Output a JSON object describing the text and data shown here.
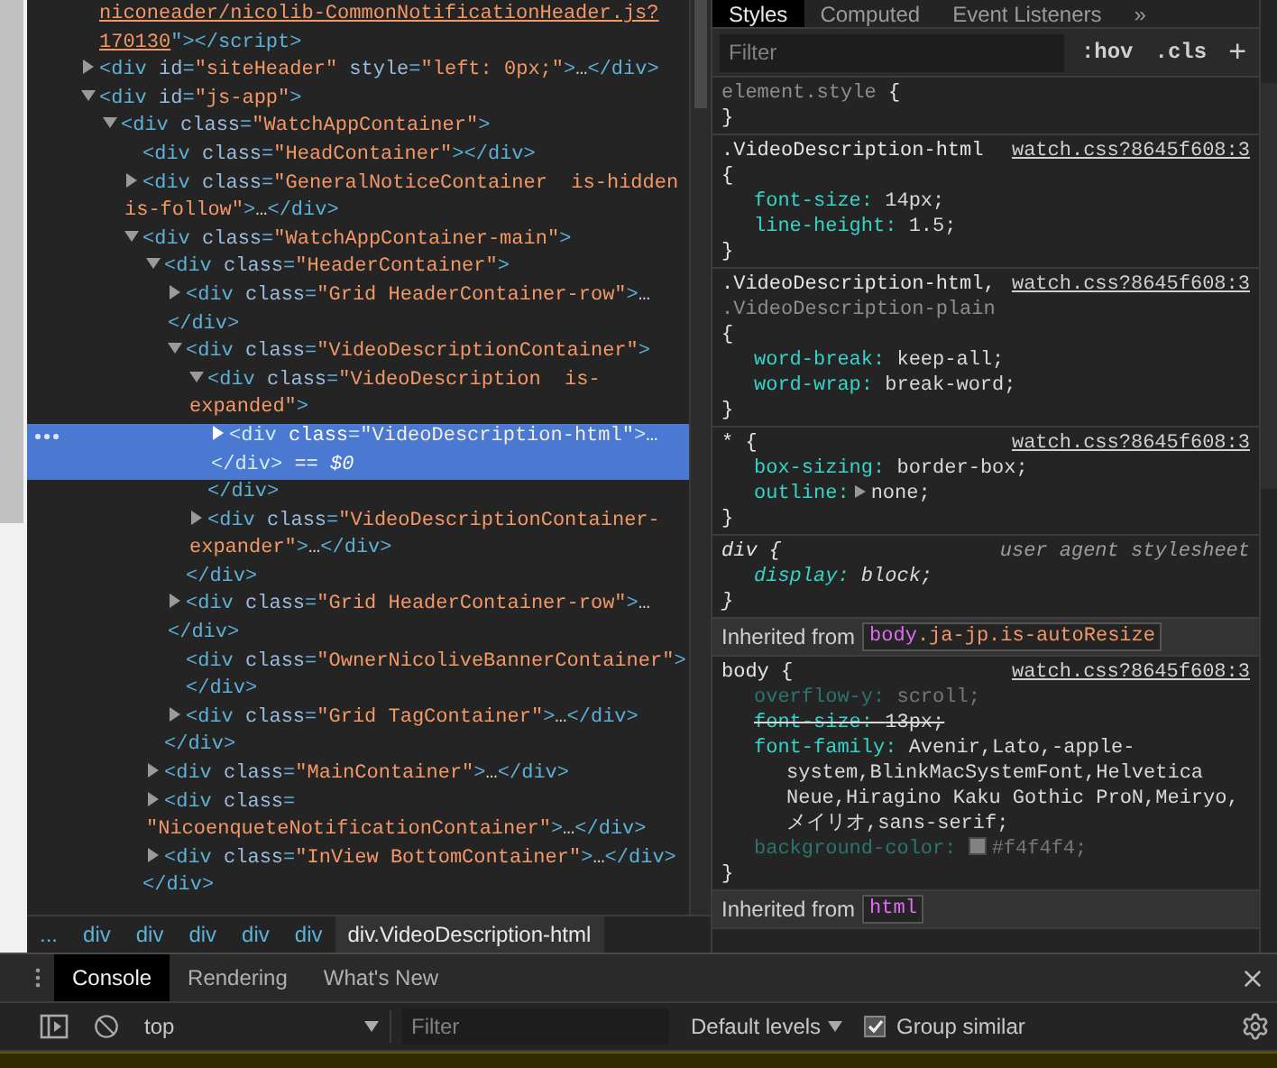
{
  "elements": {
    "tree": [
      {
        "kind": "tail",
        "link": [
          "niconeader/nicolib-CommonNotificationHeader.js?",
          "170130"
        ],
        "rest": "\"></script>"
      },
      {
        "kind": "collapsed",
        "selected": false,
        "lines": [
          "<div id=\"siteHeader\" style=\"left: 0px;\">…</div>"
        ]
      },
      {
        "kind": "expanded",
        "selected": false,
        "lines": [
          "<div id=\"js-app\">"
        ],
        "children": [
          {
            "kind": "expanded",
            "selected": false,
            "lines": [
              "<div class=\"WatchAppContainer\">"
            ],
            "children": [
              {
                "kind": "leaf",
                "selected": false,
                "lines": [
                  "<div class=\"HeadContainer\"></div>"
                ]
              },
              {
                "kind": "collapsed",
                "selected": false,
                "lines": [
                  "<div class=\"GeneralNoticeContainer  is-hidden",
                  "is-follow\">…</div>"
                ]
              },
              {
                "kind": "expanded",
                "selected": false,
                "lines": [
                  "<div class=\"WatchAppContainer-main\">"
                ],
                "closing": "</div>",
                "children": [
                  {
                    "kind": "expanded",
                    "selected": false,
                    "lines": [
                      "<div class=\"HeaderContainer\">"
                    ],
                    "closing": "</div>",
                    "children": [
                      {
                        "kind": "collapsed",
                        "selected": false,
                        "lines": [
                          "<div class=\"Grid HeaderContainer-row\">…",
                          "</div>"
                        ]
                      },
                      {
                        "kind": "expanded",
                        "selected": false,
                        "lines": [
                          "<div class=\"VideoDescriptionContainer\">"
                        ],
                        "closing": "</div>",
                        "children": [
                          {
                            "kind": "expanded",
                            "selected": false,
                            "lines": [
                              "<div class=\"VideoDescription  is-",
                              "expanded\">"
                            ],
                            "closing": "</div>",
                            "children": [
                              {
                                "kind": "collapsed",
                                "selected": true,
                                "lines": [
                                  "<div class=\"VideoDescription-html\">…",
                                  "</div>"
                                ],
                                "suffix": "== $0"
                              }
                            ]
                          },
                          {
                            "kind": "collapsed",
                            "selected": false,
                            "lines": [
                              "<div class=\"VideoDescriptionContainer-",
                              "expander\">…</div>"
                            ]
                          }
                        ]
                      },
                      {
                        "kind": "collapsed",
                        "selected": false,
                        "lines": [
                          "<div class=\"Grid HeaderContainer-row\">…",
                          "</div>"
                        ]
                      },
                      {
                        "kind": "leaf",
                        "selected": false,
                        "lines": [
                          "<div class=\"OwnerNicoliveBannerContainer\">",
                          "</div>"
                        ]
                      },
                      {
                        "kind": "collapsed",
                        "selected": false,
                        "lines": [
                          "<div class=\"Grid TagContainer\">…</div>"
                        ]
                      }
                    ]
                  },
                  {
                    "kind": "collapsed",
                    "selected": false,
                    "lines": [
                      "<div class=\"MainContainer\">…</div>"
                    ]
                  },
                  {
                    "kind": "collapsed",
                    "selected": false,
                    "lines": [
                      "<div class=",
                      "\"NicoenqueteNotificationContainer\">…</div>"
                    ]
                  },
                  {
                    "kind": "collapsed",
                    "selected": false,
                    "lines": [
                      "<div class=\"InView BottomContainer\">…</div>"
                    ]
                  }
                ]
              }
            ]
          }
        ]
      }
    ]
  },
  "breadcrumbs": [
    {
      "label": "...",
      "selected": false
    },
    {
      "label": "div",
      "selected": false
    },
    {
      "label": "div",
      "selected": false
    },
    {
      "label": "div",
      "selected": false
    },
    {
      "label": "div",
      "selected": false
    },
    {
      "label": "div",
      "selected": false
    },
    {
      "label": "div.VideoDescription-html",
      "selected": true
    }
  ],
  "styles": {
    "tabs": [
      {
        "label": "Styles",
        "selected": true
      },
      {
        "label": "Computed",
        "selected": false
      },
      {
        "label": "Event Listeners",
        "selected": false
      }
    ],
    "more": "»",
    "filter": {
      "placeholder": "Filter"
    },
    "buttons": [
      ":hov",
      ".cls",
      "+"
    ],
    "sections": [
      {
        "kind": "rule",
        "selectors": [
          {
            "text": "element.style",
            "matched": false
          }
        ],
        "open": "{",
        "close": "}",
        "user_agent": false
      },
      {
        "kind": "rule",
        "selectors": [
          {
            "text": ".VideoDescription-html",
            "matched": true
          }
        ],
        "open": "{",
        "close": "}",
        "source": "watch.css?8645f608:3",
        "user_agent": false,
        "props": [
          {
            "name": "font-size:",
            "value": "14px;",
            "inactive": false,
            "overridden": false,
            "expandable": false
          },
          {
            "name": "line-height:",
            "value": "1.5;",
            "inactive": false,
            "overridden": false,
            "expandable": false
          }
        ]
      },
      {
        "kind": "rule",
        "selectors": [
          {
            "text": ".VideoDescription-html,",
            "matched": true
          },
          {
            "text": ".VideoDescription-plain",
            "matched": false
          }
        ],
        "open": "{",
        "close": "}",
        "source": "watch.css?8645f608:3",
        "user_agent": false,
        "props": [
          {
            "name": "word-break:",
            "value": "keep-all;",
            "inactive": false,
            "overridden": false,
            "expandable": false
          },
          {
            "name": "word-wrap:",
            "value": "break-word;",
            "inactive": false,
            "overridden": false,
            "expandable": false
          }
        ]
      },
      {
        "kind": "rule",
        "selectors": [
          {
            "text": "*",
            "matched": true
          }
        ],
        "open": "{",
        "close": "}",
        "source": "watch.css?8645f608:3",
        "user_agent": false,
        "props": [
          {
            "name": "box-sizing:",
            "value": "border-box;",
            "inactive": false,
            "overridden": false,
            "expandable": false
          },
          {
            "name": "outline:",
            "value": "none;",
            "inactive": false,
            "overridden": false,
            "expandable": true
          }
        ]
      },
      {
        "kind": "rule",
        "selectors": [
          {
            "text": "div",
            "matched": true
          }
        ],
        "open": "{",
        "close": "}",
        "source": "user agent stylesheet",
        "user_agent": true,
        "props": [
          {
            "name": "display:",
            "value": "block;",
            "inactive": false,
            "overridden": false,
            "expandable": false
          }
        ]
      },
      {
        "kind": "inherited",
        "label": "Inherited from",
        "tag": "body",
        "classes": ".ja-jp.is-autoResize"
      },
      {
        "kind": "rule",
        "selectors": [
          {
            "text": "body",
            "matched": true
          }
        ],
        "open": "{",
        "close": "}",
        "source": "watch.css?8645f608:3",
        "user_agent": false,
        "props": [
          {
            "name": "overflow-y:",
            "value": "scroll;",
            "inactive": true,
            "overridden": false,
            "expandable": false
          },
          {
            "name": "font-size:",
            "value": "13px;",
            "inactive": false,
            "overridden": true,
            "expandable": false
          },
          {
            "name": "font-family:",
            "value": "Avenir,Lato,-apple-system,BlinkMacSystemFont,Helvetica Neue,Hiragino Kaku Gothic ProN,Meiryo,メイリオ,sans-serif;",
            "inactive": false,
            "overridden": false,
            "expandable": false
          },
          {
            "name": "background-color:",
            "value": "#f4f4f4;",
            "inactive": true,
            "overridden": false,
            "expandable": false,
            "swatch": true
          }
        ]
      },
      {
        "kind": "inherited",
        "label": "Inherited from",
        "tag": "html"
      }
    ]
  },
  "drawer": {
    "tabs": [
      {
        "label": "Console",
        "selected": true
      },
      {
        "label": "Rendering",
        "selected": false
      },
      {
        "label": "What's New",
        "selected": false
      }
    ],
    "context": "top",
    "filter": {
      "placeholder": "Filter"
    },
    "levels": "Default levels",
    "group_similar": {
      "label": "Group similar",
      "checked": true
    }
  }
}
